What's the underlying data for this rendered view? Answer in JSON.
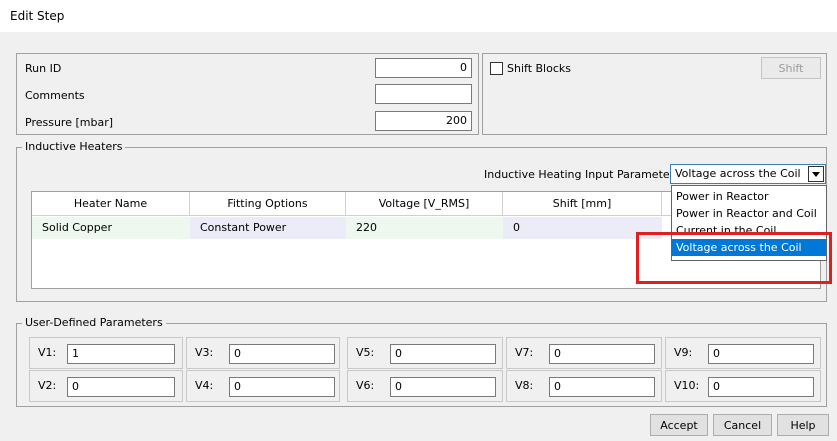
{
  "window": {
    "title": "Edit Step"
  },
  "run": {
    "run_id_label": "Run ID",
    "run_id_value": "0",
    "comments_label": "Comments",
    "comments_value": "",
    "pressure_label": "Pressure [mbar]",
    "pressure_value": "200"
  },
  "shift": {
    "checkbox_label": "Shift Blocks",
    "button_label": "Shift",
    "checked": false
  },
  "inductive": {
    "group_label": "Inductive Heaters",
    "param_label": "Inductive Heating Input Parameter:",
    "param_value": "Voltage across the Coil",
    "options": [
      "Power in Reactor",
      "Power in Reactor and Coil",
      "Current in the Coil",
      "Voltage across the Coil"
    ],
    "selected_option": "Voltage across the Coil",
    "columns": [
      "Heater Name",
      "Fitting Options",
      "Voltage [V_RMS]",
      "Shift [mm]"
    ],
    "rows": [
      {
        "heater_name": "Solid Copper",
        "fitting": "Constant Power",
        "voltage": "220",
        "shift": "0"
      }
    ]
  },
  "user_params": {
    "group_label": "User-Defined Parameters",
    "items": [
      {
        "label": "V1:",
        "value": "1"
      },
      {
        "label": "V2:",
        "value": "0"
      },
      {
        "label": "V3:",
        "value": "0"
      },
      {
        "label": "V4:",
        "value": "0"
      },
      {
        "label": "V5:",
        "value": "0"
      },
      {
        "label": "V6:",
        "value": "0"
      },
      {
        "label": "V7:",
        "value": "0"
      },
      {
        "label": "V8:",
        "value": "0"
      },
      {
        "label": "V9:",
        "value": "0"
      },
      {
        "label": "V10:",
        "value": "0"
      }
    ]
  },
  "footer": {
    "accept": "Accept",
    "cancel": "Cancel",
    "help": "Help"
  },
  "colors": {
    "highlight": "#0078d7",
    "annotation": "#e02020",
    "row_green": "#eef8ee",
    "row_lavender": "#ececf8"
  }
}
